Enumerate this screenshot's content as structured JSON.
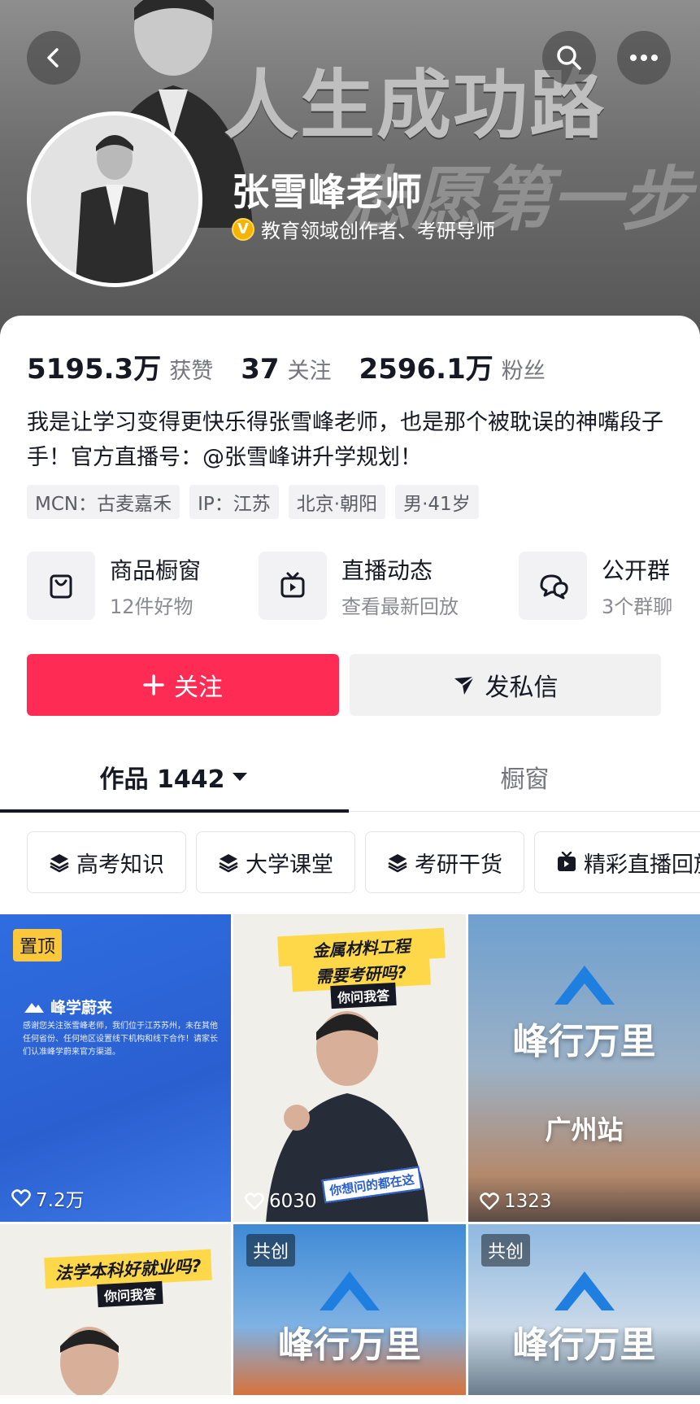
{
  "header": {
    "slogan_line1": "人生成功路",
    "slogan_line2": "志愿第一步",
    "nickname": "张雪峰老师",
    "verify_badge": "V",
    "verify_text": "教育领域创作者、考研导师"
  },
  "stats": [
    {
      "num": "5195.3万",
      "label": "获赞"
    },
    {
      "num": "37",
      "label": "关注"
    },
    {
      "num": "2596.1万",
      "label": "粉丝"
    }
  ],
  "bio": "我是让学习变得更快乐得张雪峰老师，也是那个被耽误的神嘴段子手！官方直播号：@张雪峰讲升学规划！",
  "tags": [
    "MCN：古麦嘉禾",
    "IP：江苏",
    "北京·朝阳",
    "男·41岁"
  ],
  "features": [
    {
      "title": "商品橱窗",
      "sub": "12件好物",
      "icon": "shopping-bag-icon"
    },
    {
      "title": "直播动态",
      "sub": "查看最新回放",
      "icon": "live-tv-icon"
    },
    {
      "title": "公开群",
      "sub": "3个群聊",
      "icon": "chat-bubbles-icon"
    }
  ],
  "actions": {
    "follow": "关注",
    "message": "发私信"
  },
  "tabs": {
    "works": "作品 1442",
    "shop": "橱窗"
  },
  "chips": [
    {
      "label": "高考知识",
      "icon": "layers-icon"
    },
    {
      "label": "大学课堂",
      "icon": "layers-icon"
    },
    {
      "label": "考研干货",
      "icon": "layers-icon"
    },
    {
      "label": "精彩直播回放",
      "icon": "live-tv-icon"
    }
  ],
  "videos": [
    {
      "badge": "置顶",
      "likes": "7.2万",
      "brand": "峰学蔚来",
      "notice": "感谢您关注张雪峰老师，我们位于江苏苏州，未在其他任何省份、任何地区设置线下机构和线下合作！请家长们认准峰学蔚来官方渠道。"
    },
    {
      "likes": "6030",
      "band1": "金属材料工程",
      "band2": "需要考研吗?",
      "band3": "你问我答",
      "caption": "你想问的都在这"
    },
    {
      "likes": "1323",
      "title": "峰行万里",
      "subtitle": "广州站"
    },
    {
      "band1": "法学本科好就业吗?",
      "band3": "你问我答"
    },
    {
      "badge": "共创",
      "title": "峰行万里"
    },
    {
      "badge": "共创",
      "title": "峰行万里"
    }
  ],
  "colors": {
    "accent": "#fe2c55",
    "verify": "#f4b400",
    "pin": "#fbc83c"
  }
}
